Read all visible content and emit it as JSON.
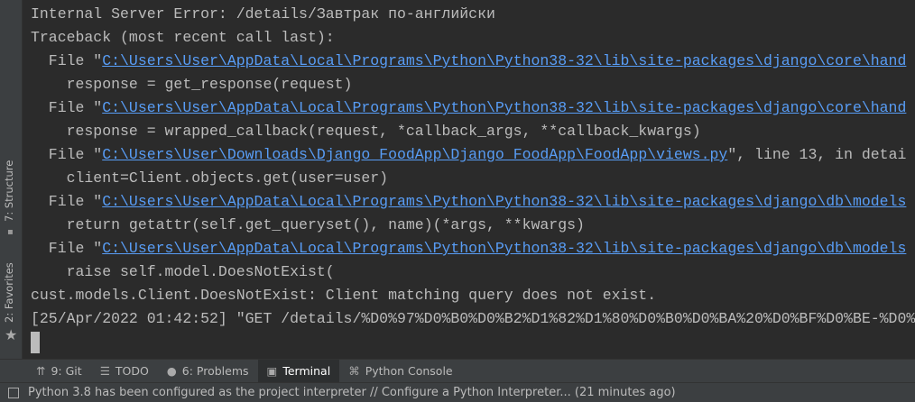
{
  "sidebar": {
    "structure": "7: Structure",
    "favorites": "2: Favorites"
  },
  "terminal": {
    "lines": [
      {
        "pre": "Internal Server Error: /details/Завтрак по-английски",
        "link": "",
        "post": ""
      },
      {
        "pre": "Traceback (most recent call last):",
        "link": "",
        "post": ""
      },
      {
        "pre": "  File \"",
        "link": "C:\\Users\\User\\AppData\\Local\\Programs\\Python\\Python38-32\\lib\\site-packages\\django\\core\\hand",
        "post": ""
      },
      {
        "pre": "    response = get_response(request)",
        "link": "",
        "post": ""
      },
      {
        "pre": "  File \"",
        "link": "C:\\Users\\User\\AppData\\Local\\Programs\\Python\\Python38-32\\lib\\site-packages\\django\\core\\hand",
        "post": ""
      },
      {
        "pre": "    response = wrapped_callback(request, *callback_args, **callback_kwargs)",
        "link": "",
        "post": ""
      },
      {
        "pre": "  File \"",
        "link": "C:\\Users\\User\\Downloads\\Django_FoodApp\\Django_FoodApp\\FoodApp\\views.py",
        "post": "\", line 13, in detai"
      },
      {
        "pre": "    client=Client.objects.get(user=user)",
        "link": "",
        "post": ""
      },
      {
        "pre": "  File \"",
        "link": "C:\\Users\\User\\AppData\\Local\\Programs\\Python\\Python38-32\\lib\\site-packages\\django\\db\\models",
        "post": ""
      },
      {
        "pre": "    return getattr(self.get_queryset(), name)(*args, **kwargs)",
        "link": "",
        "post": ""
      },
      {
        "pre": "  File \"",
        "link": "C:\\Users\\User\\AppData\\Local\\Programs\\Python\\Python38-32\\lib\\site-packages\\django\\db\\models",
        "post": ""
      },
      {
        "pre": "    raise self.model.DoesNotExist(",
        "link": "",
        "post": ""
      },
      {
        "pre": "cust.models.Client.DoesNotExist: Client matching query does not exist.",
        "link": "",
        "post": ""
      },
      {
        "pre": "[25/Apr/2022 01:42:52] \"GET /details/%D0%97%D0%B0%D0%B2%D1%82%D1%80%D0%B0%D0%BA%20%D0%BF%D0%BE-%D0%",
        "link": "",
        "post": ""
      }
    ]
  },
  "toolbar": {
    "tabs": [
      {
        "label": "9: Git",
        "icon": "git-icon",
        "active": false
      },
      {
        "label": "TODO",
        "icon": "list-icon",
        "active": false
      },
      {
        "label": "6: Problems",
        "icon": "problems-icon",
        "active": false
      },
      {
        "label": "Terminal",
        "icon": "terminal-icon",
        "active": true
      },
      {
        "label": "Python Console",
        "icon": "python-icon",
        "active": false
      }
    ]
  },
  "status": {
    "message": "Python 3.8 has been configured as the project interpreter // Configure a Python Interpreter... (21 minutes ago)"
  }
}
